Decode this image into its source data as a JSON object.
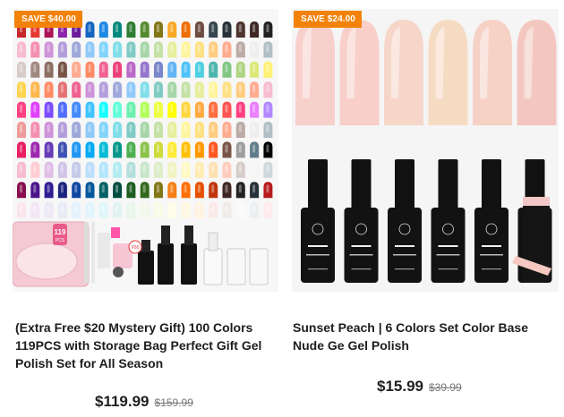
{
  "products": [
    {
      "badge": "SAVE $40.00",
      "title": "(Extra Free $20 Mystery Gift) 100 Colors 119PCS with Storage Bag Perfect Gift Gel Polish Set for All Season",
      "price": "$119.99",
      "old_price": "$159.99",
      "image_labels": {
        "case_number": "119",
        "case_sub": "PCS",
        "brand": "Beetles",
        "x60": "X60"
      }
    },
    {
      "badge": "SAVE $24.00",
      "title": "Sunset Peach | 6 Colors Set Color Base Nude Ge Gel Polish",
      "price": "$15.99",
      "old_price": "$39.99",
      "image_labels": {
        "brand": "Beetles",
        "line1": "BEETLES COLOR BASE",
        "line2": "BUILDER & COLOR"
      }
    }
  ],
  "colors": {
    "badge": "#f2820a",
    "text": "#1d1d1d",
    "old_price": "#777777"
  }
}
